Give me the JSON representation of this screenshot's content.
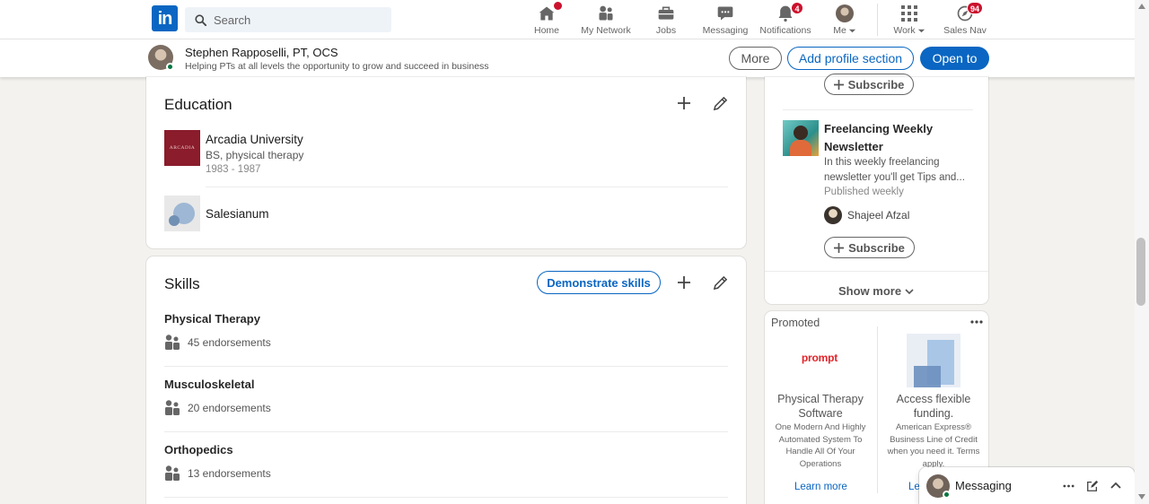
{
  "nav": {
    "logo": "in",
    "search_placeholder": "Search",
    "items": [
      {
        "label": "Home",
        "badge": ""
      },
      {
        "label": "My Network",
        "badge": ""
      },
      {
        "label": "Jobs",
        "badge": ""
      },
      {
        "label": "Messaging",
        "badge": ""
      },
      {
        "label": "Notifications",
        "badge": "4"
      },
      {
        "label": "Me",
        "badge": ""
      },
      {
        "label": "Work",
        "badge": ""
      },
      {
        "label": "Sales Nav",
        "badge": "94"
      }
    ]
  },
  "sticky": {
    "name": "Stephen Rapposelli, PT, OCS",
    "headline": "Helping PTs at all levels the opportunity to grow and succeed in business",
    "more": "More",
    "add_section": "Add profile section",
    "open_to": "Open to"
  },
  "education": {
    "title": "Education",
    "items": [
      {
        "school": "Arcadia University",
        "degree": "BS, physical therapy",
        "dates": "1983 - 1987",
        "logo_text": "ARCADIA"
      },
      {
        "school": "Salesianum",
        "degree": "",
        "dates": ""
      }
    ]
  },
  "skills": {
    "title": "Skills",
    "demonstrate": "Demonstrate skills",
    "items": [
      {
        "name": "Physical Therapy",
        "endorsements": "45 endorsements"
      },
      {
        "name": "Musculoskeletal",
        "endorsements": "20 endorsements"
      },
      {
        "name": "Orthopedics",
        "endorsements": "13 endorsements"
      }
    ]
  },
  "newsletters": {
    "subscribe": "Subscribe",
    "item": {
      "title": "Freelancing Weekly Newsletter",
      "desc": "In this weekly freelancing newsletter you'll get Tips and...",
      "frequency": "Published weekly",
      "author": "Shajeel Afzal"
    },
    "show_more": "Show more"
  },
  "promoted": {
    "label": "Promoted",
    "ads": [
      {
        "brand": "prompt",
        "headline": "Physical Therapy Software",
        "desc": "One Modern And Highly Automated System To Handle All Of Your Operations",
        "cta": "Learn more"
      },
      {
        "headline": "Access flexible funding.",
        "desc": "American Express® Business Line of Credit when you need it. Terms apply.",
        "cta": "Le"
      }
    ]
  },
  "messaging": {
    "label": "Messaging"
  },
  "colors": {
    "brand": "#0a66c2",
    "badge": "#cb112d",
    "online": "#057642",
    "arcadia": "#8a1c2b"
  }
}
